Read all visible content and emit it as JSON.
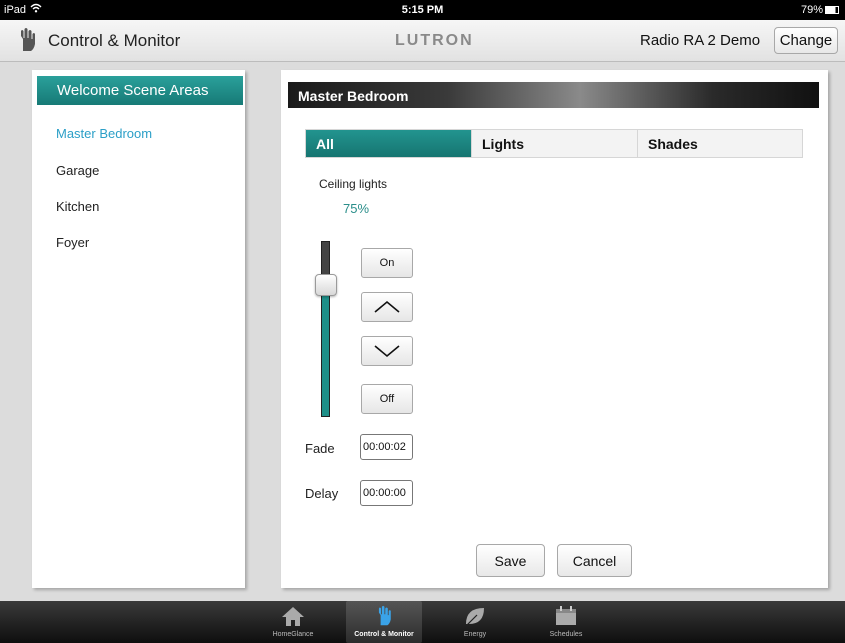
{
  "status_bar": {
    "carrier": "iPad",
    "time": "5:15 PM",
    "battery": "79%"
  },
  "top_bar": {
    "title": "Control & Monitor",
    "logo": "LUTRON",
    "system_name": "Radio RA 2 Demo",
    "change_label": "Change"
  },
  "sidebar": {
    "header": "Welcome Scene Areas",
    "items": [
      {
        "label": "Master Bedroom",
        "active": true
      },
      {
        "label": "Garage",
        "active": false
      },
      {
        "label": "Kitchen",
        "active": false
      },
      {
        "label": "Foyer",
        "active": false
      }
    ]
  },
  "main": {
    "title": "Master Bedroom",
    "tabs": [
      {
        "label": "All",
        "active": true
      },
      {
        "label": "Lights",
        "active": false
      },
      {
        "label": "Shades",
        "active": false
      }
    ],
    "zone": {
      "name": "Ceiling lights",
      "level_text": "75%",
      "level": 0.75
    },
    "buttons": {
      "on": "On",
      "off": "Off",
      "raise_icon": "chevron-up-icon",
      "lower_icon": "chevron-down-icon"
    },
    "fade": {
      "label": "Fade",
      "value": "00:00:02"
    },
    "delay": {
      "label": "Delay",
      "value": "00:00:00"
    },
    "save_label": "Save",
    "cancel_label": "Cancel"
  },
  "tab_bar": {
    "items": [
      {
        "label": "HomeGlance",
        "icon": "home-icon",
        "active": false
      },
      {
        "label": "Control & Monitor",
        "icon": "hand-icon",
        "active": true
      },
      {
        "label": "Energy",
        "icon": "leaf-icon",
        "active": false
      },
      {
        "label": "Schedules",
        "icon": "calendar-icon",
        "active": false
      }
    ]
  },
  "colors": {
    "accent": "#1e8f88",
    "sidebar_active": "#2b9fc7",
    "tabbar": "#1a1a1a"
  }
}
